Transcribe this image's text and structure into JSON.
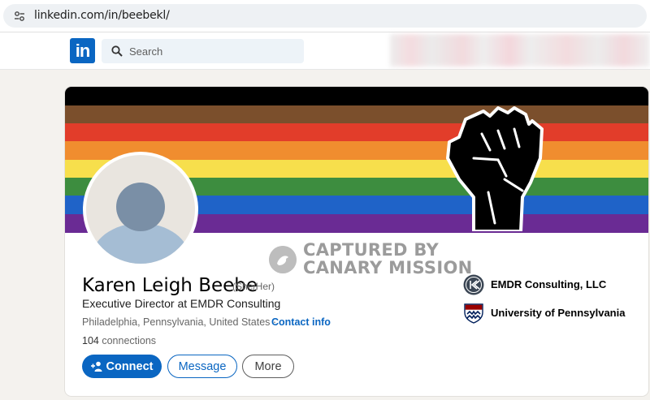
{
  "browser": {
    "url": "linkedin.com/in/beebekl/"
  },
  "header": {
    "logo_text": "in",
    "search_placeholder": "Search"
  },
  "banner": {
    "stripe_colors": [
      "#000000",
      "#7b4f2c",
      "#e23d2a",
      "#f08d2f",
      "#f7df4c",
      "#3d8d3f",
      "#1f63c8",
      "#6a2b94"
    ]
  },
  "watermark": {
    "line1": "CAPTURED BY",
    "line2": "CANARY MISSION"
  },
  "profile": {
    "name": "Karen Leigh Beebe",
    "pronouns": "(She/Her)",
    "headline": "Executive Director at EMDR Consulting",
    "location": "Philadelphia, Pennsylvania, United States",
    "location_separator": " · ",
    "contact_link": "Contact info",
    "connections_count": "104",
    "connections_label": " connections"
  },
  "actions": {
    "connect": "Connect",
    "message": "Message",
    "more": "More"
  },
  "organizations": [
    {
      "name": "EMDR Consulting, LLC",
      "icon": "emdr-logo-icon"
    },
    {
      "name": "University of Pennsylvania",
      "icon": "upenn-shield-icon"
    }
  ],
  "colors": {
    "linkedin_blue": "#0a66c2",
    "page_bg": "#f4f2ee"
  }
}
